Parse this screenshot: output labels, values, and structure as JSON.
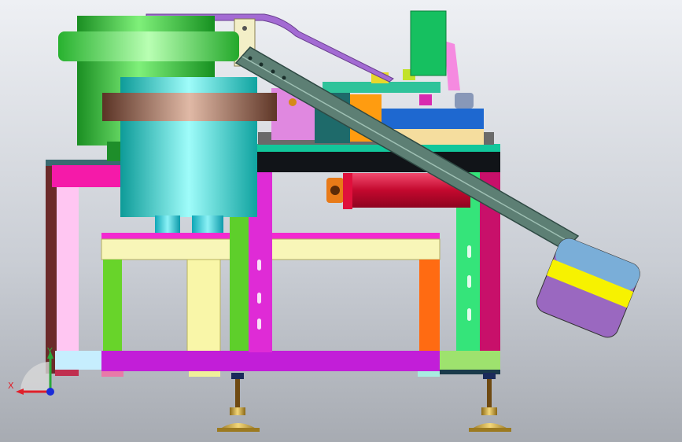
{
  "viewport": {
    "title": "",
    "background_top": "#eef0f4",
    "background_bottom": "#a7abb2"
  },
  "axis_triad": {
    "x_label": "X",
    "y_label": "Y",
    "x_color": "#e0202a",
    "y_color": "#2aa83a",
    "z_color": "#1a2cd8"
  },
  "model": {
    "parts": [
      "vibratory-bowl-feeder",
      "feeder-base-cylinder",
      "linear-chute",
      "output-bin",
      "servo-motor",
      "work-table",
      "machine-frame",
      "leveling-feet",
      "control-box"
    ],
    "colors": {
      "bowl_green": "#3fd13b",
      "cylinder_cyan": "#22d5d0",
      "bronze_ring": "#9b6a52",
      "frame_magenta": "#e21aa8",
      "frame_purple": "#c71ad3",
      "frame_yellow": "#f5f3b0",
      "frame_orange": "#ff6a10",
      "frame_green": "#35e275",
      "motor_red": "#e0103c",
      "chute_teal": "#5d7f74",
      "bin_blue": "#7aaed8",
      "bin_yellow": "#f7f200",
      "bin_purple": "#9a68c0",
      "control_green": "#16c060",
      "foot_gold": "#c9a338"
    }
  }
}
